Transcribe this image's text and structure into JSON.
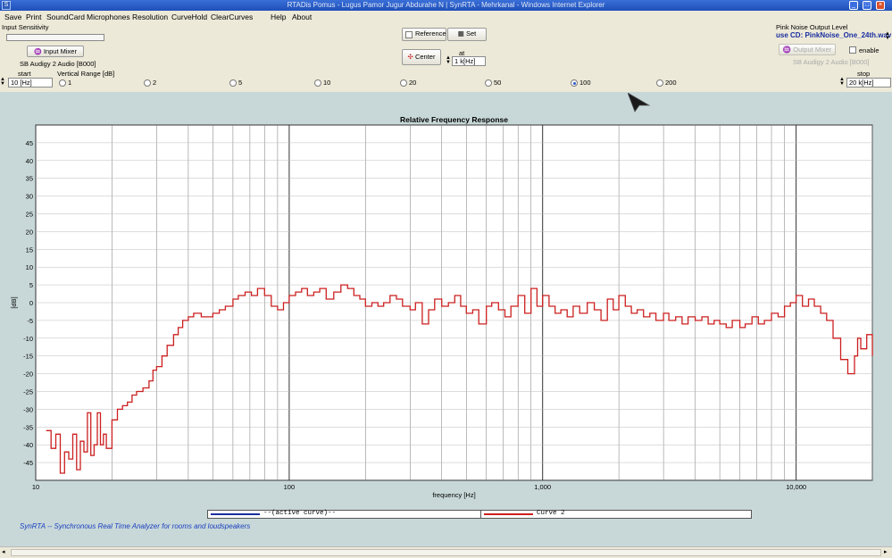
{
  "window": {
    "title": "RTADis Pomus - Lugus Pamor Jugur Abdurahe N | SynRTA - Mehrkanal - Windows Internet Explorer"
  },
  "menu": [
    "Save",
    "Print",
    "SoundCard",
    "Microphones",
    "Resolution",
    "CurveHold",
    "ClearCurves",
    "Help",
    "About"
  ],
  "input": {
    "section_label": "Input Sensitivity",
    "mixer_button": "Input Mixer",
    "device": "SB Audigy 2 Audio [B000]"
  },
  "reference": {
    "checkbox_label": "Reference",
    "set_button": "Set",
    "center_button": "Center",
    "at_label": "at",
    "at_value": "1 k[Hz]"
  },
  "pink_noise": {
    "section_label": "Pink Noise Output Level",
    "use_cd": "use CD: PinkNoise_One_24th.wav",
    "enable_label": "enable",
    "mixer_button": "Output Mixer",
    "device": "SB Audigy 2 Audio [B000]"
  },
  "range": {
    "start_label": "start",
    "start_value": "10 [Hz]",
    "vertical_label": "Vertical Range [dB]",
    "options": [
      "1",
      "2",
      "5",
      "10",
      "20",
      "50",
      "100",
      "200"
    ],
    "selected": "100",
    "stop_label": "stop",
    "stop_value": "20 k[Hz]"
  },
  "legend": {
    "active_label": "--(active curve)--",
    "active_color": "#1a2fa0",
    "curve2_label": "Curve 2",
    "curve2_color": "#cc1f1f"
  },
  "branding": "SynRTA -- Synchronous Real Time Analyzer for rooms and loudspeakers",
  "chart_data": {
    "type": "line",
    "title": "Relative Frequency Response",
    "xlabel": "frequency [Hz]",
    "ylabel": "[dB]",
    "xscale": "log",
    "xlim": [
      10,
      20000
    ],
    "ylim": [
      -50,
      50
    ],
    "x_tick_labels": [
      {
        "v": 10,
        "t": "10"
      },
      {
        "v": 100,
        "t": "100"
      },
      {
        "v": 1000,
        "t": "1,000"
      },
      {
        "v": 10000,
        "t": "10,000"
      }
    ],
    "y_ticks": [
      45,
      40,
      35,
      30,
      25,
      20,
      15,
      10,
      5,
      0,
      -5,
      -10,
      -15,
      -20,
      -25,
      -30,
      -35,
      -40,
      -45
    ],
    "series": [
      {
        "name": "Curve 2",
        "color": "#cc1f1f",
        "step": true,
        "points": [
          [
            11.0,
            -36
          ],
          [
            11.5,
            -41
          ],
          [
            12.0,
            -37
          ],
          [
            12.5,
            -48
          ],
          [
            13.0,
            -42
          ],
          [
            13.5,
            -44
          ],
          [
            14.0,
            -37
          ],
          [
            14.5,
            -47
          ],
          [
            15.0,
            -39
          ],
          [
            15.5,
            -42
          ],
          [
            16.0,
            -31
          ],
          [
            16.5,
            -43
          ],
          [
            17.0,
            -40
          ],
          [
            17.5,
            -31
          ],
          [
            18.0,
            -40
          ],
          [
            18.5,
            -37
          ],
          [
            19.0,
            -41
          ],
          [
            20.0,
            -33
          ],
          [
            21.0,
            -30
          ],
          [
            22.0,
            -29
          ],
          [
            23.0,
            -28
          ],
          [
            24.0,
            -26
          ],
          [
            25.0,
            -25
          ],
          [
            26.5,
            -24
          ],
          [
            28.0,
            -22
          ],
          [
            29.0,
            -19
          ],
          [
            30.0,
            -18
          ],
          [
            31.5,
            -15
          ],
          [
            33.0,
            -12
          ],
          [
            35.0,
            -9
          ],
          [
            36.5,
            -7
          ],
          [
            38.0,
            -5
          ],
          [
            40.0,
            -4
          ],
          [
            42.0,
            -3
          ],
          [
            45.0,
            -4
          ],
          [
            47.5,
            -4
          ],
          [
            50.0,
            -3
          ],
          [
            53.0,
            -2
          ],
          [
            56.0,
            -1
          ],
          [
            60.0,
            1
          ],
          [
            63.0,
            2
          ],
          [
            67.0,
            3
          ],
          [
            71.0,
            2
          ],
          [
            75.0,
            4
          ],
          [
            80.0,
            2
          ],
          [
            85.0,
            -1
          ],
          [
            90.0,
            -2
          ],
          [
            95.0,
            0
          ],
          [
            100,
            2
          ],
          [
            106,
            3
          ],
          [
            112,
            4
          ],
          [
            118,
            2
          ],
          [
            125,
            3
          ],
          [
            132,
            4
          ],
          [
            140,
            1
          ],
          [
            150,
            3
          ],
          [
            160,
            5
          ],
          [
            170,
            4
          ],
          [
            180,
            2
          ],
          [
            190,
            1
          ],
          [
            200,
            -1
          ],
          [
            212,
            0
          ],
          [
            224,
            -1
          ],
          [
            236,
            0
          ],
          [
            250,
            2
          ],
          [
            265,
            1
          ],
          [
            280,
            -1
          ],
          [
            300,
            -2
          ],
          [
            315,
            0
          ],
          [
            335,
            -6
          ],
          [
            355,
            -2
          ],
          [
            375,
            1
          ],
          [
            400,
            -1
          ],
          [
            425,
            0
          ],
          [
            450,
            2
          ],
          [
            475,
            -1
          ],
          [
            500,
            -3
          ],
          [
            530,
            -2
          ],
          [
            560,
            -6
          ],
          [
            600,
            -1
          ],
          [
            630,
            0
          ],
          [
            670,
            -2
          ],
          [
            710,
            -4
          ],
          [
            750,
            -1
          ],
          [
            800,
            2
          ],
          [
            850,
            -3
          ],
          [
            900,
            4
          ],
          [
            950,
            -1
          ],
          [
            1000,
            2
          ],
          [
            1060,
            -1
          ],
          [
            1120,
            -3
          ],
          [
            1180,
            -2
          ],
          [
            1250,
            -4
          ],
          [
            1320,
            -1
          ],
          [
            1400,
            -3
          ],
          [
            1500,
            0
          ],
          [
            1600,
            -2
          ],
          [
            1700,
            -5
          ],
          [
            1800,
            1
          ],
          [
            1900,
            -2
          ],
          [
            2000,
            2
          ],
          [
            2120,
            -1
          ],
          [
            2240,
            -3
          ],
          [
            2360,
            -2
          ],
          [
            2500,
            -4
          ],
          [
            2650,
            -3
          ],
          [
            2800,
            -5
          ],
          [
            3000,
            -3
          ],
          [
            3150,
            -5
          ],
          [
            3350,
            -4
          ],
          [
            3550,
            -6
          ],
          [
            3750,
            -4
          ],
          [
            4000,
            -5
          ],
          [
            4250,
            -4
          ],
          [
            4500,
            -6
          ],
          [
            4750,
            -5
          ],
          [
            5000,
            -6
          ],
          [
            5300,
            -7
          ],
          [
            5600,
            -5
          ],
          [
            6000,
            -7
          ],
          [
            6300,
            -6
          ],
          [
            6700,
            -4
          ],
          [
            7100,
            -6
          ],
          [
            7500,
            -5
          ],
          [
            8000,
            -3
          ],
          [
            8500,
            -4
          ],
          [
            9000,
            -1
          ],
          [
            9500,
            0
          ],
          [
            10000,
            2
          ],
          [
            10600,
            -1
          ],
          [
            11200,
            1
          ],
          [
            11800,
            -1
          ],
          [
            12500,
            -3
          ],
          [
            13200,
            -5
          ],
          [
            14000,
            -10
          ],
          [
            15000,
            -16
          ],
          [
            16000,
            -20
          ],
          [
            17000,
            -15
          ],
          [
            17500,
            -10
          ],
          [
            18000,
            -13
          ],
          [
            19000,
            -9
          ],
          [
            20000,
            -15
          ]
        ]
      }
    ],
    "grid": true
  }
}
